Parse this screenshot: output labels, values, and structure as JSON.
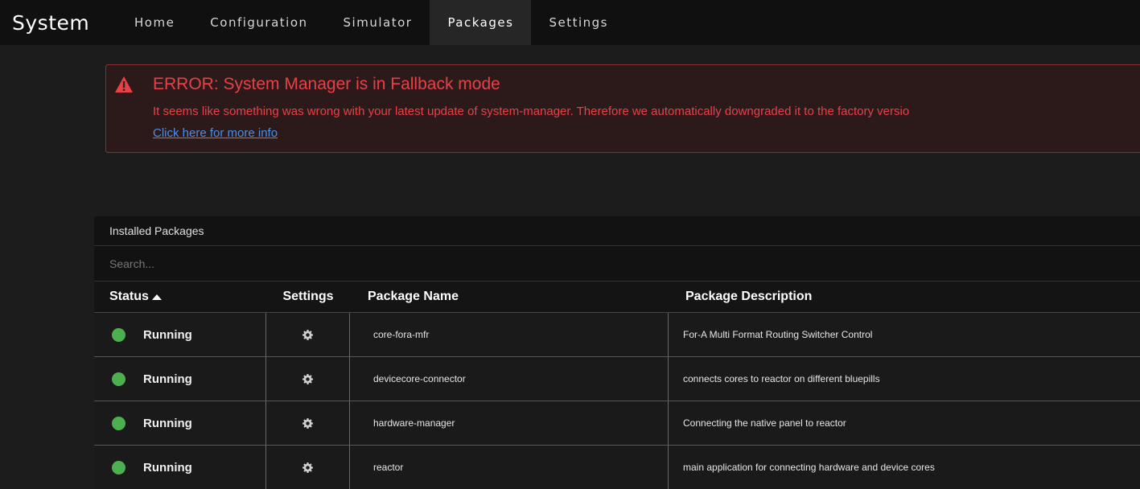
{
  "nav": {
    "brand": "System",
    "tabs": [
      {
        "label": "Home"
      },
      {
        "label": "Configuration"
      },
      {
        "label": "Simulator"
      },
      {
        "label": "Packages"
      },
      {
        "label": "Settings"
      }
    ],
    "active_tab": "Packages"
  },
  "error": {
    "title": "ERROR: System Manager is in Fallback mode",
    "message": "It seems like something was wrong with your latest update of system-manager. Therefore we automatically downgraded it to the factory versio",
    "link": "Click here for more info",
    "color": "#e94047"
  },
  "packages": {
    "header": "Installed Packages",
    "search_placeholder": "Search...",
    "columns": {
      "status": "Status",
      "settings": "Settings",
      "name": "Package Name",
      "description": "Package Description"
    },
    "rows": [
      {
        "status": "Running",
        "name": "core-fora-mfr",
        "description": "For-A Multi Format Routing Switcher Control"
      },
      {
        "status": "Running",
        "name": "devicecore-connector",
        "description": "connects cores to reactor on different bluepills"
      },
      {
        "status": "Running",
        "name": "hardware-manager",
        "description": "Connecting the native panel to reactor"
      },
      {
        "status": "Running",
        "name": "reactor",
        "description": "main application for connecting hardware and device cores"
      }
    ],
    "running_color": "#4caf50"
  }
}
